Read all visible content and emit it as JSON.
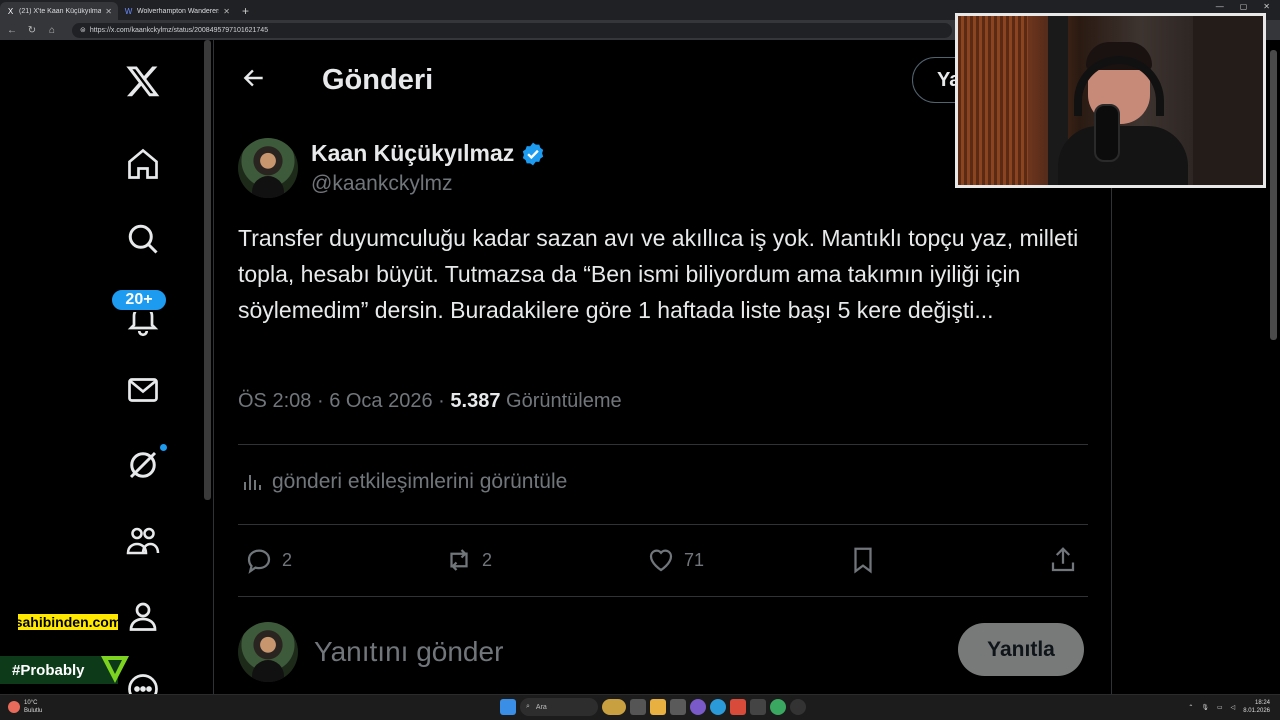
{
  "browser": {
    "tabs": [
      {
        "favicon": "X",
        "title": "(21) X'te Kaan Küçükyılmaz: \"Transfer",
        "active": true
      },
      {
        "favicon": "W",
        "title": "Wolverhampton Wanderers - Kulüp",
        "active": false
      }
    ],
    "url": "https://x.com/kaankckylmz/status/2008495797101621745"
  },
  "header": {
    "title": "Gönderi",
    "reply_button_label": "Yanıtla"
  },
  "sidebar": {
    "icons": [
      "x-logo-icon",
      "home-icon",
      "search-icon",
      "notifications-icon",
      "messages-icon",
      "grok-icon",
      "communities-icon",
      "profile-icon",
      "more-icon"
    ],
    "notifications_badge": "20+"
  },
  "tweet": {
    "author_name": "Kaan Küçükyılmaz",
    "handle": "@kaankckylmz",
    "text": "Transfer duyumculuğu kadar sazan avı ve akıllıca iş yok. Mantıklı topçu yaz, milleti topla, hesabı büyüt. Tutmazsa da “Ben ismi biliyordum ama takımın iyiliği için söylemedim” dersin. Buradakilere göre 1 haftada liste başı 5 kere değişti...",
    "time": "ÖS 2:08",
    "separator": "·",
    "date": "6 Oca 2026",
    "views_count": "5.387",
    "views_label": "Görüntüleme",
    "engagements_link": "gönderi etkileşimlerini görüntüle",
    "replies": "2",
    "reposts": "2",
    "likes": "71"
  },
  "compose": {
    "placeholder": "Yanıtını gönder",
    "button_label": "Yanıtla"
  },
  "overlays": {
    "sponsor": "sahibinden.com",
    "hashtag": "#Probably"
  },
  "taskbar": {
    "temperature": "10°C",
    "weather": "Bulutlu",
    "search_placeholder": "Ara",
    "time": "18:24",
    "date": "8.01.2026"
  },
  "colors": {
    "accent": "#1d9bf0",
    "text": "#e7e9ea",
    "muted": "#71767b",
    "border": "#2f3336"
  }
}
